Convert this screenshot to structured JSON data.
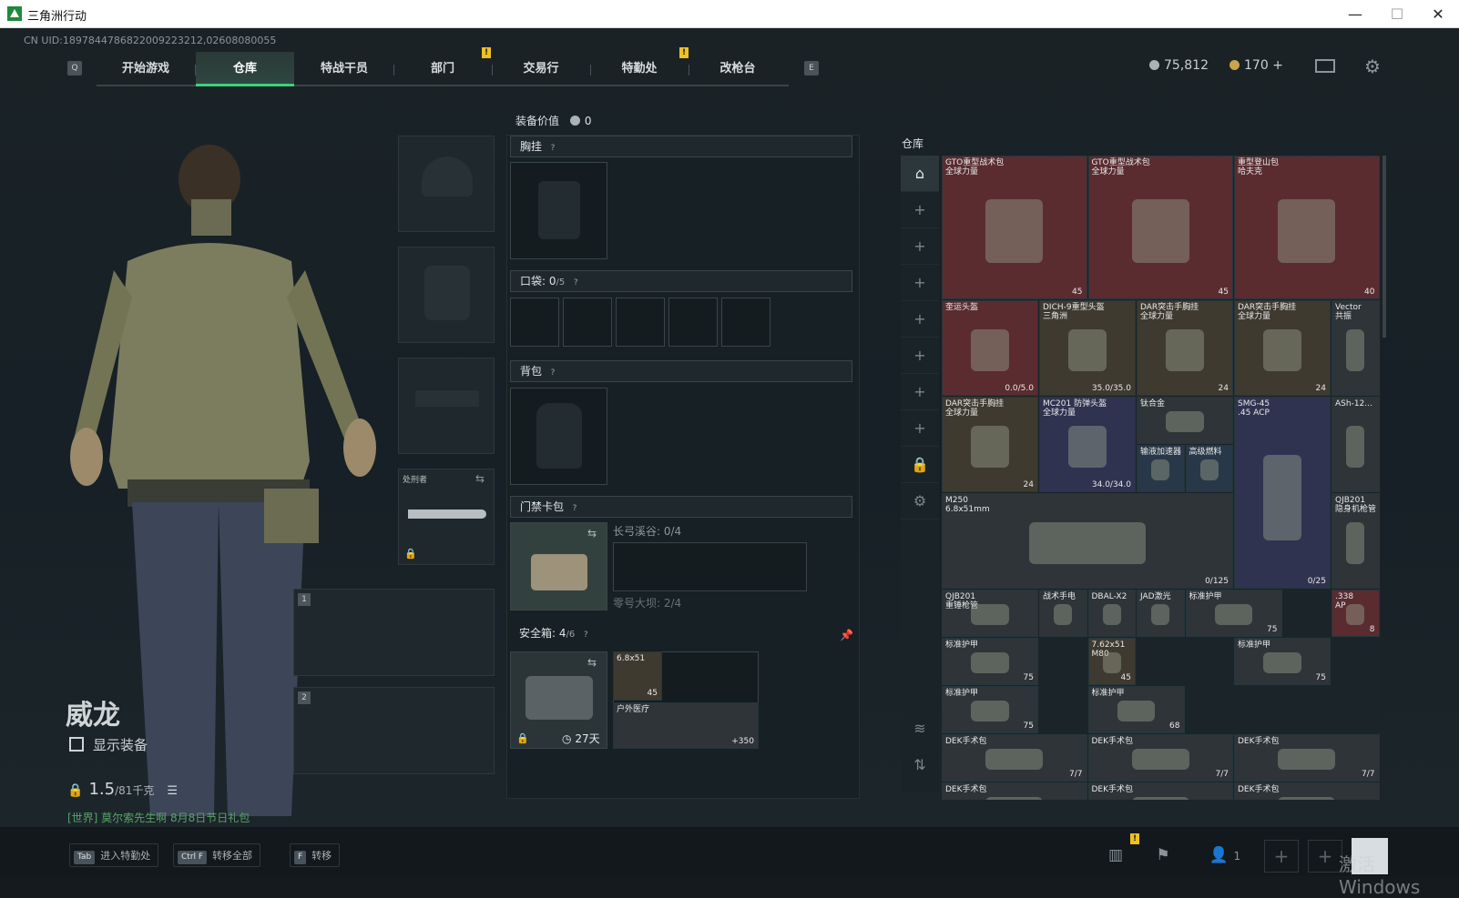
{
  "window": {
    "title": "三角洲行动",
    "controls": [
      "—",
      "☐",
      "✕"
    ]
  },
  "uid": "CN UID:1897844786822009223212,02608080055",
  "nav": {
    "left_key": "Q",
    "right_key": "E",
    "tabs": [
      {
        "label": "开始游戏"
      },
      {
        "label": "仓库"
      },
      {
        "label": "特战干员"
      },
      {
        "label": "部门"
      },
      {
        "label": "交易行"
      },
      {
        "label": "特勤处"
      },
      {
        "label": "改枪台"
      }
    ],
    "active_tab": "仓库",
    "notif_mark": "!"
  },
  "currency": {
    "silver": "75,812",
    "gold": "170",
    "gold_plus": "+"
  },
  "operator": {
    "name": "威龙",
    "show_equipment": "显示装备",
    "weight": "1.5",
    "weight_max": "/81千克"
  },
  "chat_line": "[世界] 莫尔索先生啊 8月8日节日礼包",
  "melee_slot": {
    "label": "处刑者"
  },
  "weapon_slots": [
    "1",
    "2"
  ],
  "middle": {
    "equip_value_label": "装备价值",
    "equip_value": "0",
    "chest": "胸挂",
    "pocket": "口袋:",
    "pocket_count": "0",
    "pocket_max": "/5",
    "backpack": "背包",
    "keycard": "门禁卡包",
    "keycard_zone1": "长弓溪谷: 0/4",
    "keycard_zone2": "零号大坝: 2/4",
    "safebox": "安全箱:",
    "safebox_count": "4",
    "safebox_max": "/6",
    "safebox_time": "27天",
    "safe_item1": "6.8x51",
    "safe_item1_count": "45",
    "safe_item2": "户外医疗",
    "safe_item2_count": "+350",
    "help": "?"
  },
  "warehouse": {
    "title": "仓库",
    "sidebar_icons": [
      "home-icon",
      "plus-icon",
      "plus-icon",
      "plus-icon",
      "plus-icon",
      "plus-icon",
      "plus-icon",
      "plus-icon",
      "lock-icon",
      "gear-icon",
      "layers-icon",
      "sort-icon"
    ],
    "items": [
      {
        "name": "GTO重型战术包\n全球力量",
        "count": "45",
        "color": "red"
      },
      {
        "name": "GTO重型战术包\n全球力量",
        "count": "45",
        "color": "red"
      },
      {
        "name": "重型登山包\n哈夫克",
        "count": "40",
        "color": "red"
      },
      {
        "name": "奎运头盔",
        "count": "0.0/5.0",
        "color": "red"
      },
      {
        "name": "DICH-9重型头盔\n三角洲",
        "count": "35.0/35.0",
        "color": "brown"
      },
      {
        "name": "DAR突击手胸挂\n全球力量",
        "count": "24",
        "color": "brown"
      },
      {
        "name": "DAR突击手胸挂\n全球力量",
        "count": "24",
        "color": "brown"
      },
      {
        "name": "Vector\n共振",
        "count": "",
        "color": "gray"
      },
      {
        "name": "DAR突击手胸挂\n全球力量",
        "count": "24",
        "color": "brown"
      },
      {
        "name": "MC201 防弹头盔\n全球力量",
        "count": "34.0/34.0",
        "color": "purple"
      },
      {
        "name": "钛合金",
        "count": "",
        "color": "gray"
      },
      {
        "name": "SMG-45\n.45 ACP",
        "count": "0/25",
        "color": "purple"
      },
      {
        "name": "ASh-12...",
        "count": "",
        "color": "gray"
      },
      {
        "name": "输液加速器",
        "count": "",
        "color": "blue"
      },
      {
        "name": "高级燃料",
        "count": "",
        "color": "blue"
      },
      {
        "name": "M250\n6.8x51mm",
        "count": "0/125",
        "color": "gray"
      },
      {
        "name": "QJB201\n隐身机枪管",
        "count": "",
        "color": "gray"
      },
      {
        "name": "QJB201\n重锤枪管",
        "count": "",
        "color": "gray"
      },
      {
        "name": "战术手电",
        "count": "",
        "color": "gray"
      },
      {
        "name": "DBAL-X2",
        "count": "",
        "color": "gray"
      },
      {
        "name": "JAD激光",
        "count": "",
        "color": "gray"
      },
      {
        "name": "标准护甲",
        "count": "75",
        "color": "gray"
      },
      {
        "name": ".338\nAP",
        "count": "8",
        "color": "red"
      },
      {
        "name": "标准护甲",
        "count": "75",
        "color": "gray"
      },
      {
        "name": "7.62x51\nM80",
        "count": "45",
        "color": "brown"
      },
      {
        "name": "标准护甲",
        "count": "75",
        "color": "gray"
      },
      {
        "name": "标准护甲",
        "count": "75",
        "color": "gray"
      },
      {
        "name": "标准护甲",
        "count": "68",
        "color": "gray"
      },
      {
        "name": "DEK手术包",
        "count": "7/7",
        "color": "gray"
      },
      {
        "name": "DEK手术包",
        "count": "7/7",
        "color": "gray"
      },
      {
        "name": "DEK手术包",
        "count": "7/7",
        "color": "gray"
      },
      {
        "name": "DEK手术包",
        "count": "",
        "color": "gray"
      },
      {
        "name": "DEK手术包",
        "count": "",
        "color": "gray"
      },
      {
        "name": "DEK手术包",
        "count": "",
        "color": "gray"
      }
    ]
  },
  "bottom": {
    "keys": [
      {
        "cap": "Tab",
        "label": "进入特勤处"
      },
      {
        "cap": "Ctrl F",
        "label": "转移全部"
      },
      {
        "cap": "F",
        "label": "转移"
      }
    ],
    "friends_count": "1",
    "watermark": "激活 Windows"
  },
  "colors": {
    "accent": "#3fd07f",
    "red_item": "#5a2c30",
    "brown_item": "#3e3a30",
    "purple_item": "#2f3350"
  }
}
